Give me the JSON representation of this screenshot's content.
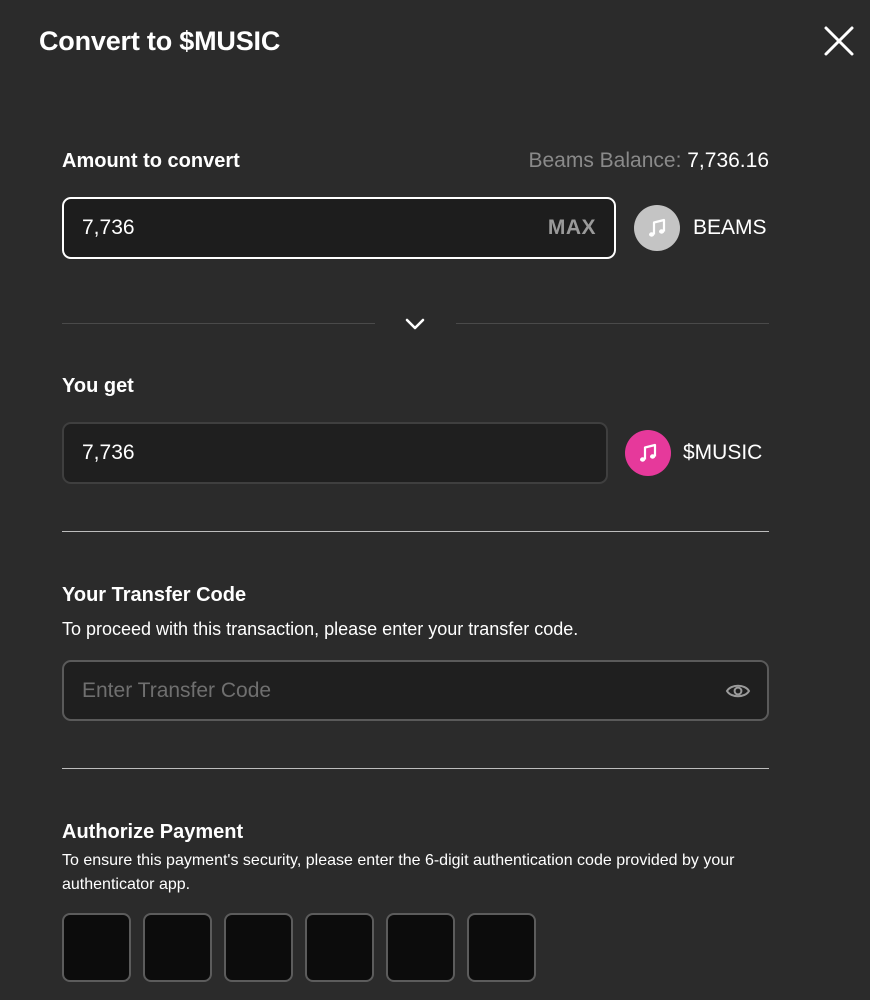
{
  "header": {
    "title": "Convert to $MUSIC"
  },
  "from": {
    "label": "Amount to convert",
    "balance_label": "Beams Balance:",
    "balance_value": "7,736.16",
    "amount": "7,736",
    "max_label": "MAX",
    "token": {
      "name": "BEAMS",
      "icon": "music-note-icon",
      "color": "#c4c4c4"
    }
  },
  "to": {
    "label": "You get",
    "amount": "7,736",
    "token": {
      "name": "$MUSIC",
      "icon": "music-note-icon",
      "color": "#e6399b"
    }
  },
  "transfer": {
    "title": "Your Transfer Code",
    "description": "To proceed with this transaction, please enter your transfer code.",
    "placeholder": "Enter Transfer Code",
    "visibility_icon": "eye-icon"
  },
  "authorize": {
    "title": "Authorize Payment",
    "description": "To ensure this payment's security, please enter the 6-digit authentication code provided by your authenticator app.",
    "digit_count": 6
  },
  "icons": {
    "close": "close-icon",
    "swap": "chevron-down-icon"
  }
}
